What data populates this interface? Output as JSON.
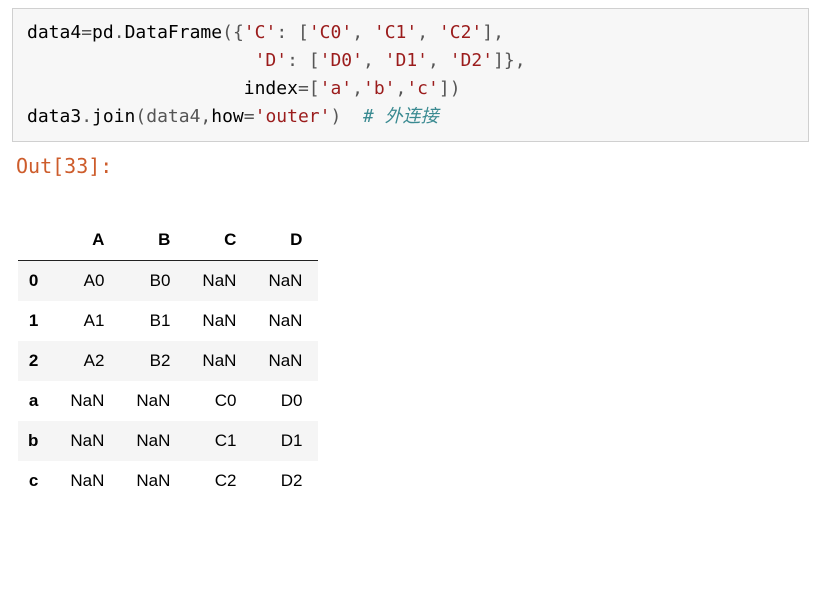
{
  "code": {
    "line1": {
      "t1": "data4",
      "t2": "=",
      "t3": "pd",
      "t4": ".",
      "t5": "DataFrame",
      "t6": "({",
      "t7": "'C'",
      "t8": ": [",
      "t9": "'C0'",
      "t10": ", ",
      "t11": "'C1'",
      "t12": ", ",
      "t13": "'C2'",
      "t14": "],"
    },
    "line2": {
      "pad": "                     ",
      "t1": "'D'",
      "t2": ": [",
      "t3": "'D0'",
      "t4": ", ",
      "t5": "'D1'",
      "t6": ", ",
      "t7": "'D2'",
      "t8": "]},"
    },
    "line3": {
      "pad": "                    ",
      "t1": "index",
      "t2": "=[",
      "t3": "'a'",
      "t4": ",",
      "t5": "'b'",
      "t6": ",",
      "t7": "'c'",
      "t8": "])"
    },
    "line4": {
      "t1": "data3",
      "t2": ".",
      "t3": "join",
      "t4": "(data4,",
      "t5": "how",
      "t6": "=",
      "t7": "'outer'",
      "t8": ")  ",
      "t9": "# 外连接"
    }
  },
  "out_label": "Out[33]:",
  "chart_data": {
    "type": "table",
    "columns": [
      "A",
      "B",
      "C",
      "D"
    ],
    "index": [
      "0",
      "1",
      "2",
      "a",
      "b",
      "c"
    ],
    "rows": [
      [
        "A0",
        "B0",
        "NaN",
        "NaN"
      ],
      [
        "A1",
        "B1",
        "NaN",
        "NaN"
      ],
      [
        "A2",
        "B2",
        "NaN",
        "NaN"
      ],
      [
        "NaN",
        "NaN",
        "C0",
        "D0"
      ],
      [
        "NaN",
        "NaN",
        "C1",
        "D1"
      ],
      [
        "NaN",
        "NaN",
        "C2",
        "D2"
      ]
    ]
  }
}
